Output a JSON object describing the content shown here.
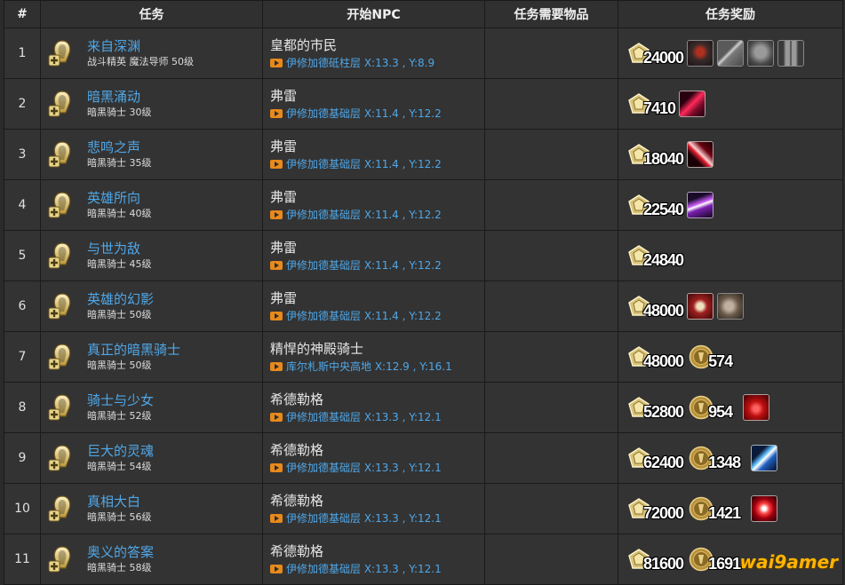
{
  "headers": {
    "num": "#",
    "task": "任务",
    "npc": "开始NPC",
    "items": "任务需要物品",
    "rewards": "任务奖励"
  },
  "rows": [
    {
      "num": "1",
      "name": "来自深渊",
      "sub": "战斗精英 魔法导师 50级",
      "npc": "皇都的市民",
      "loc": "伊修加德砥柱层 X:13.3 , Y:8.9",
      "gil": "24000",
      "coins": "",
      "items": [
        "demon-helm",
        "sword",
        "armor-chest",
        "armor-legs"
      ]
    },
    {
      "num": "2",
      "name": "暗黑涌动",
      "sub": "暗黑骑士 30级",
      "npc": "弗雷",
      "loc": "伊修加德基础层 X:11.4 , Y:12.2",
      "gil": "7410",
      "coins": "",
      "items": [
        "skill-red-slash"
      ]
    },
    {
      "num": "3",
      "name": "悲鸣之声",
      "sub": "暗黑骑士 35级",
      "npc": "弗雷",
      "loc": "伊修加德基础层 X:11.4 , Y:12.2",
      "gil": "18040",
      "coins": "",
      "items": [
        "skill-red-strike"
      ]
    },
    {
      "num": "4",
      "name": "英雄所向",
      "sub": "暗黑骑士 40级",
      "npc": "弗雷",
      "loc": "伊修加德基础层 X:11.4 , Y:12.2",
      "gil": "22540",
      "coins": "",
      "items": [
        "skill-purple-slash"
      ]
    },
    {
      "num": "5",
      "name": "与世为敌",
      "sub": "暗黑骑士 45级",
      "npc": "弗雷",
      "loc": "伊修加德基础层 X:11.4 , Y:12.2",
      "gil": "24840",
      "coins": "",
      "items": []
    },
    {
      "num": "6",
      "name": "英雄的幻影",
      "sub": "暗黑骑士 50级",
      "npc": "弗雷",
      "loc": "伊修加德基础层 X:11.4 , Y:12.2",
      "gil": "48000",
      "coins": "",
      "items": [
        "hourglass",
        "gauntlet"
      ]
    },
    {
      "num": "7",
      "name": "真正的暗黑骑士",
      "sub": "暗黑骑士 50级",
      "npc": "精悍的神殿骑士",
      "loc": "库尔札斯中央高地 X:12.9 , Y:16.1",
      "gil": "48000",
      "coins": "574",
      "items": []
    },
    {
      "num": "8",
      "name": "骑士与少女",
      "sub": "暗黑骑士 52级",
      "npc": "希德勒格",
      "loc": "伊修加德基础层 X:13.3 , Y:12.1",
      "gil": "52800",
      "coins": "954",
      "items": [
        "skill-red-orb"
      ]
    },
    {
      "num": "9",
      "name": "巨大的灵魂",
      "sub": "暗黑骑士 54级",
      "npc": "希德勒格",
      "loc": "伊修加德基础层 X:13.3 , Y:12.1",
      "gil": "62400",
      "coins": "1348",
      "items": [
        "skill-blue-strike"
      ]
    },
    {
      "num": "10",
      "name": "真相大白",
      "sub": "暗黑骑士 56级",
      "npc": "希德勒格",
      "loc": "伊修加德基础层 X:13.3 , Y:12.1",
      "gil": "72000",
      "coins": "1421",
      "items": [
        "skill-red-burst"
      ]
    },
    {
      "num": "11",
      "name": "奥义的答案",
      "sub": "暗黑骑士 58级",
      "npc": "希德勒格",
      "loc": "伊修加德基础层 X:13.3 , Y:12.1",
      "gil": "81600",
      "coins": "1691",
      "items": []
    }
  ],
  "watermark": "wai9amer",
  "colors": {
    "background": "#2b2b2b",
    "cell": "#333333",
    "link": "#4fa7e8",
    "location_icon": "#e8891c",
    "gil_gold": "#d8c27a",
    "watermark": "#ffb400"
  }
}
